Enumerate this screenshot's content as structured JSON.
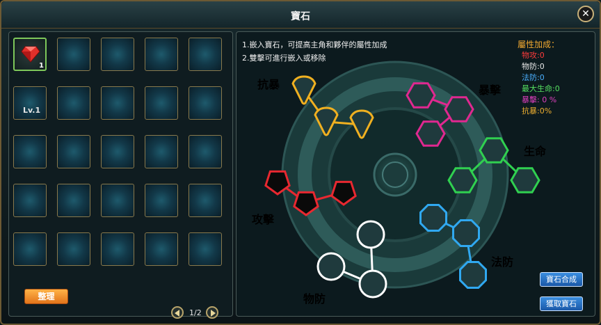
{
  "window": {
    "title": "寶石",
    "close_symbol": "✕"
  },
  "inventory": {
    "slots": 25,
    "item": {
      "name": "ruby-gem-icon",
      "count": "1",
      "level": "Lv.1",
      "color": "#e0302a"
    },
    "page": "1/2",
    "sort_label": "整理"
  },
  "instructions": {
    "line1": "1.嵌入寶石，可提高主角和夥伴的屬性加成",
    "line2": "2.雙擊可進行嵌入或移除"
  },
  "stats": {
    "header": "屬性加成：",
    "items": [
      {
        "text": "物攻:0",
        "color": "#ff3b3b"
      },
      {
        "text": "物防:0",
        "color": "#e8e8e8"
      },
      {
        "text": "法防:0",
        "color": "#4ab0ff"
      },
      {
        "text": "最大生命:0",
        "color": "#56e060"
      },
      {
        "text": "暴擊: 0 %",
        "color": "#e040c0"
      },
      {
        "text": "抗暴:0%",
        "color": "#f0b030"
      }
    ]
  },
  "trees": [
    {
      "label": "抗暴",
      "color": "#f0b020"
    },
    {
      "label": "暴擊",
      "color": "#e02890"
    },
    {
      "label": "生命",
      "color": "#30d050"
    },
    {
      "label": "攻擊",
      "color": "#e82830"
    },
    {
      "label": "法防",
      "color": "#30a8f0"
    },
    {
      "label": "物防",
      "color": "#ffffff"
    }
  ],
  "buttons": {
    "synthesize": "寶石合成",
    "extract": "獲取寶石"
  }
}
